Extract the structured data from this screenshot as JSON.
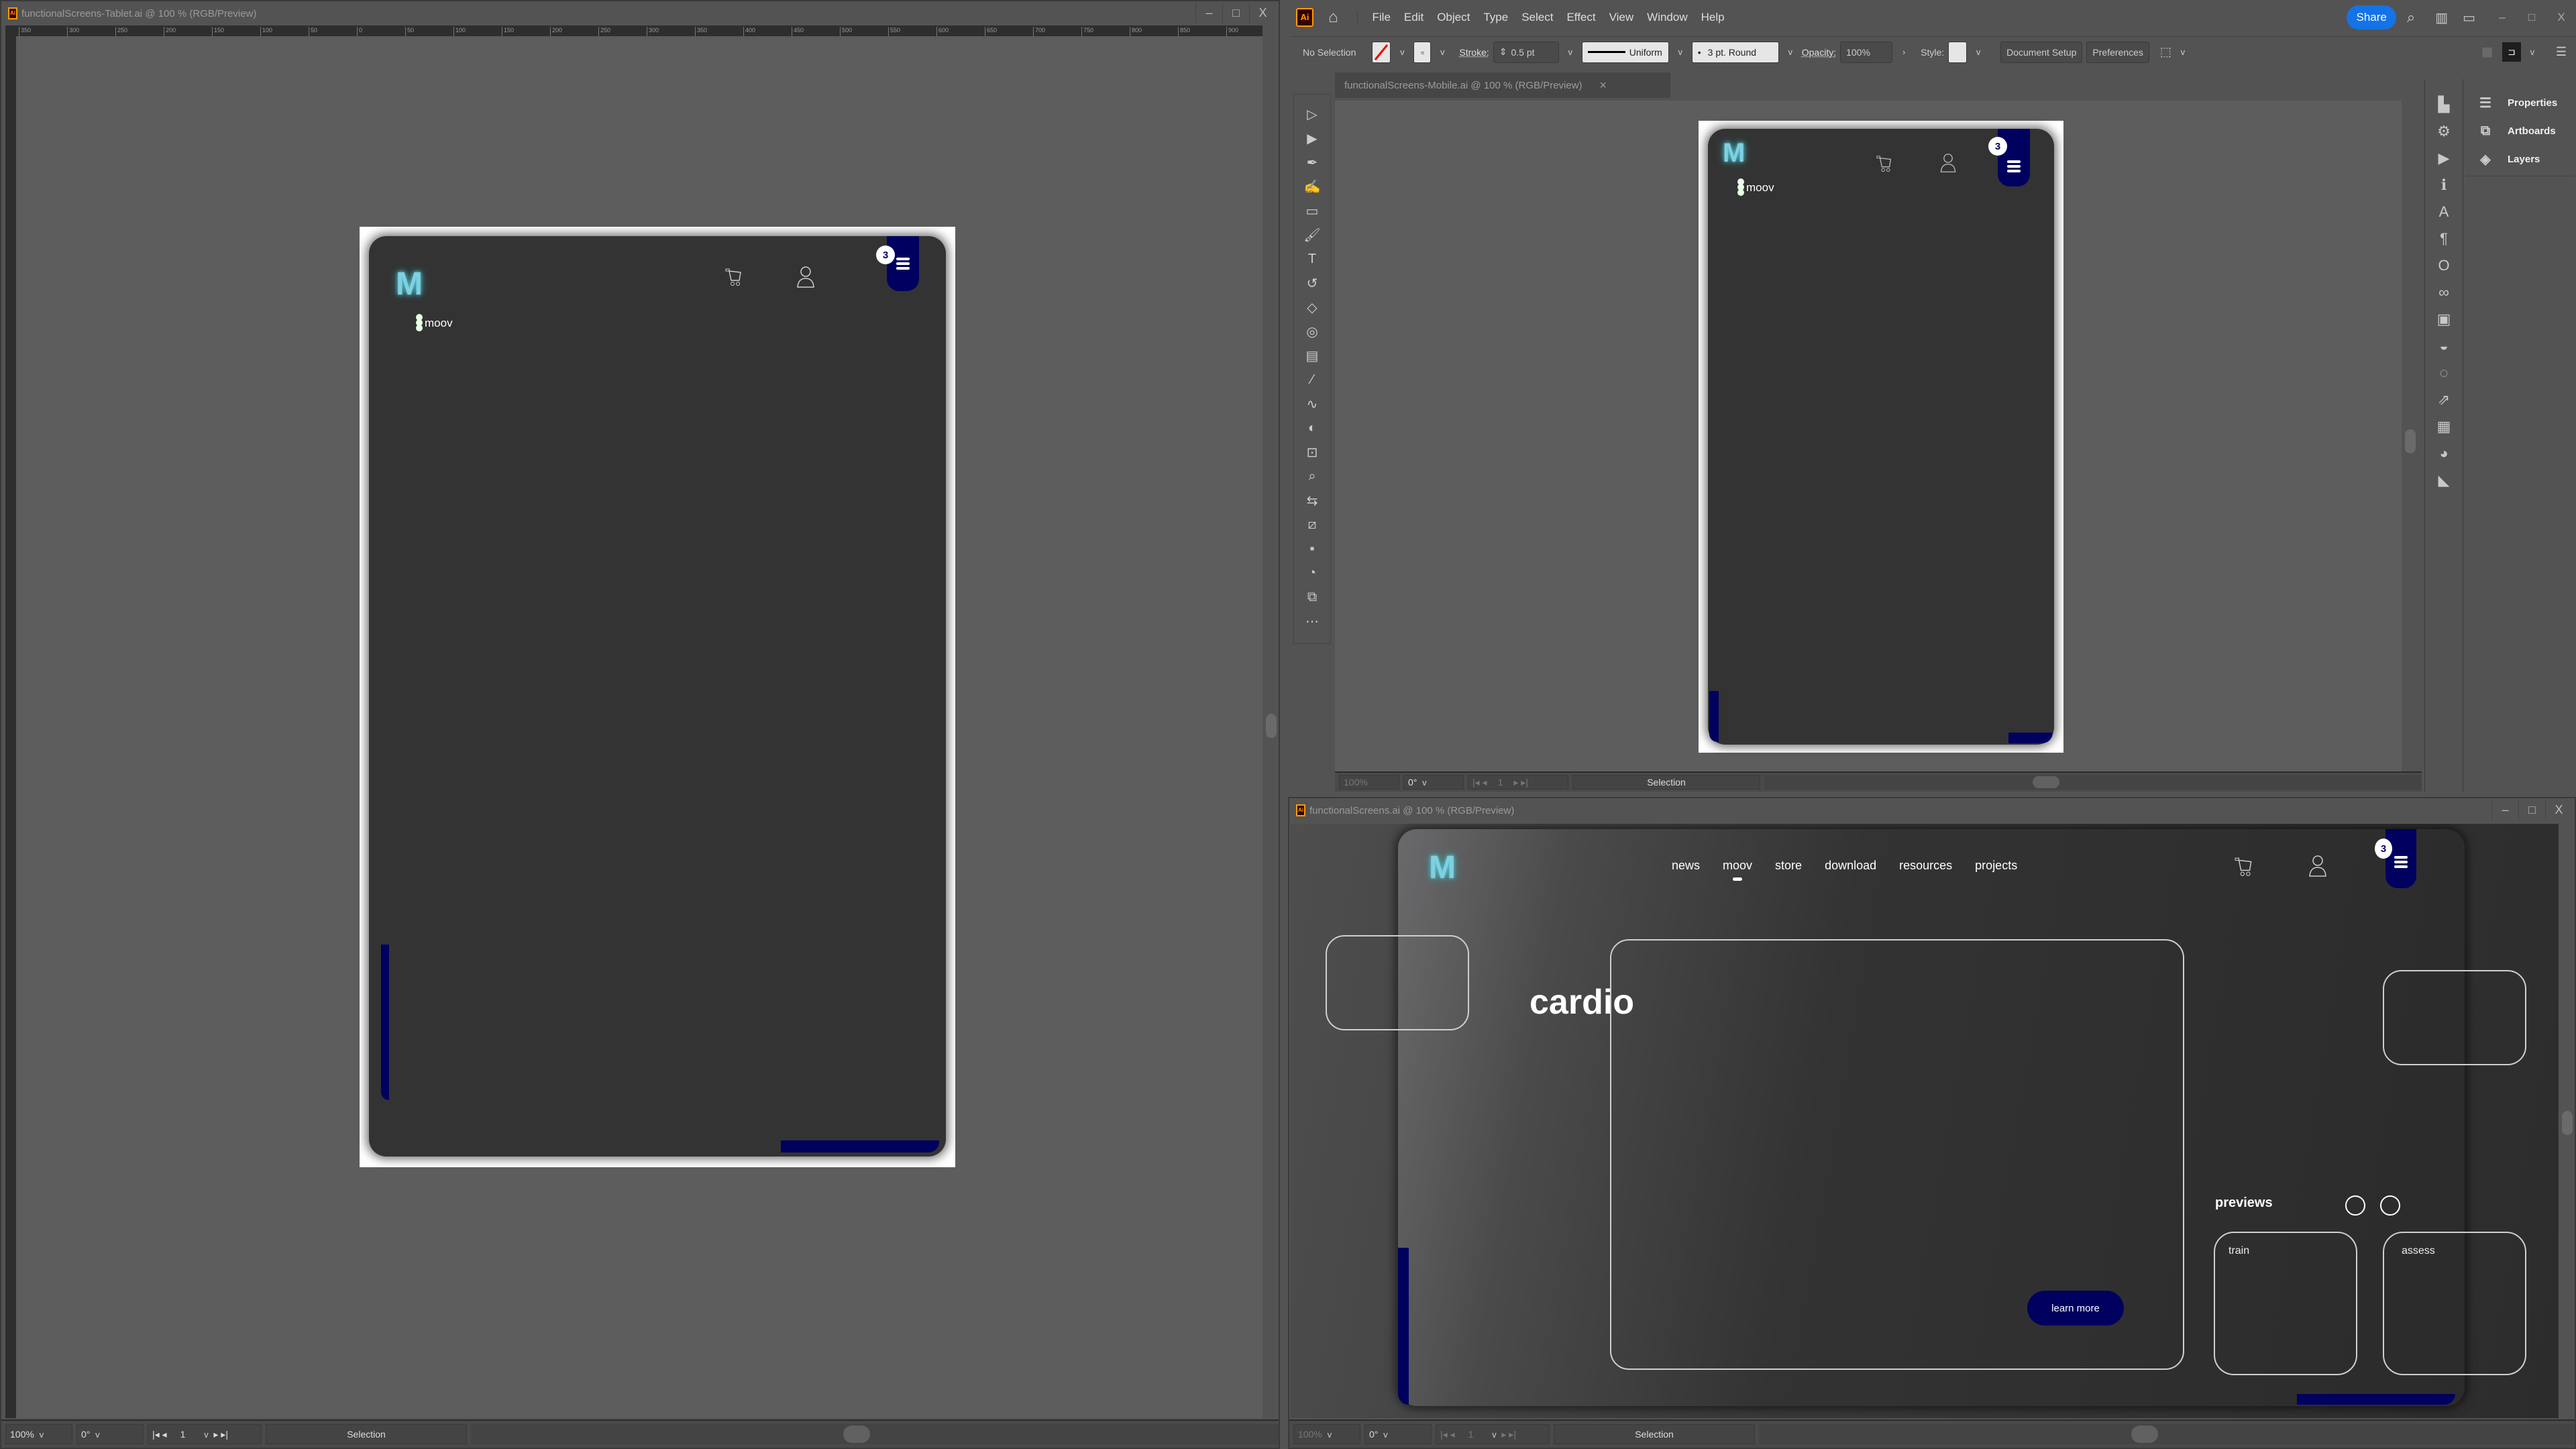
{
  "app": {
    "logo_label": "Ai",
    "menu": [
      "File",
      "Edit",
      "Object",
      "Type",
      "Select",
      "Effect",
      "View",
      "Window",
      "Help"
    ],
    "share_label": "Share",
    "icons": [
      "home-icon",
      "search-icon",
      "arrange-documents-icon",
      "workspace-icon"
    ]
  },
  "control_bar": {
    "selection_label": "No Selection",
    "stroke_label": "Stroke:",
    "stroke_value": "0.5 pt",
    "profile_value": "Uniform",
    "brush_value": "3 pt. Round",
    "opacity_label": "Opacity:",
    "opacity_value": "100%",
    "style_label": "Style:",
    "document_setup_label": "Document Setup",
    "preferences_label": "Preferences"
  },
  "windows": {
    "tablet": {
      "title": "functionalScreens-Tablet.ai @ 100 % (RGB/Preview)",
      "ruler_ticks": [
        "350",
        "300",
        "250",
        "200",
        "150",
        "100",
        "50",
        "0",
        "50",
        "100",
        "150",
        "200",
        "250",
        "300",
        "350",
        "400",
        "450",
        "500",
        "550",
        "600",
        "650",
        "700",
        "750",
        "800",
        "850",
        "900"
      ],
      "status": {
        "zoom": "100%",
        "rotation": "0°",
        "artboard": "1",
        "tool": "Selection"
      }
    },
    "mobile": {
      "title": "functionalScreens-Mobile.ai @ 100 % (RGB/Preview)",
      "close_label": "×",
      "status": {
        "zoom": "100%",
        "rotation": "0°",
        "artboard": "1",
        "tool": "Selection"
      }
    },
    "desktop": {
      "title": "functionalScreens.ai @ 100 % (RGB/Preview)",
      "status": {
        "zoom": "100%",
        "rotation": "0°",
        "artboard": "1",
        "tool": "Selection"
      }
    }
  },
  "window_controls": {
    "minimize": "–",
    "maximize": "□",
    "close": "X"
  },
  "right_panels": {
    "items": [
      {
        "label": "Properties",
        "icon": "properties-icon"
      },
      {
        "label": "Artboards",
        "icon": "artboards-icon"
      },
      {
        "label": "Layers",
        "icon": "layers-icon"
      }
    ]
  },
  "site": {
    "logo": "M",
    "brand": "moov",
    "cart_badge": "3",
    "nav": [
      "news",
      "moov",
      "store",
      "download",
      "resources",
      "projects"
    ],
    "active_nav": "moov",
    "hero_title": "cardio",
    "cta_label": "learn more",
    "previews_title": "previews",
    "preview_cards": [
      "train",
      "assess"
    ],
    "accent_color": "#00005f",
    "logo_color": "#7fd0e0"
  }
}
